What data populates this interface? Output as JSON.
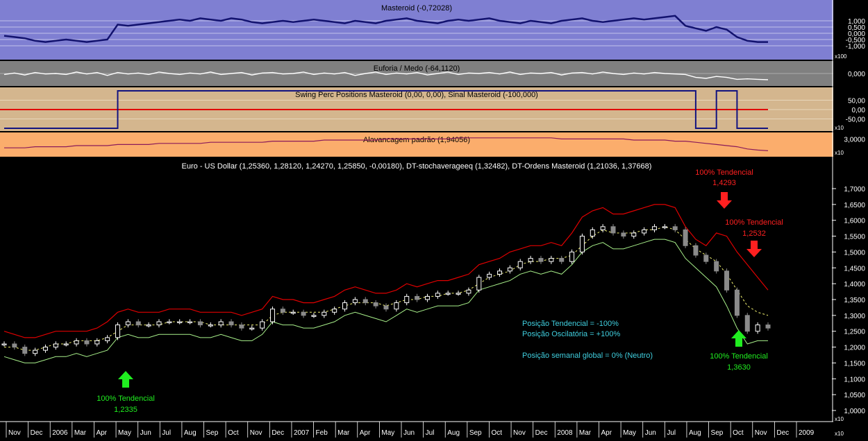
{
  "panels": {
    "masteroid": {
      "title": "Masteroid (-0,72028)",
      "ticks": [
        "1,000",
        "0,500",
        "0,000",
        "-0,500",
        "-1,000"
      ],
      "multiplier": "x100",
      "colors": {
        "bg": "#7f7fd2",
        "line": "#12126e"
      }
    },
    "euforia": {
      "title": "Euforia / Medo (-64,1120)",
      "ticks": [
        "0,000"
      ],
      "colors": {
        "bg": "#808080",
        "line": "#ffffff"
      }
    },
    "swing": {
      "title": "Swing Perc Positions Masteroid (0,00, 0,00), Sinal Masteroid (-100,000)",
      "ticks": [
        "50,00",
        "0,00",
        "-50,00"
      ],
      "multiplier": "x10",
      "colors": {
        "bg": "#d4b68e",
        "signal": "#121280",
        "perc": "#10a010",
        "zero": "#e00000"
      }
    },
    "alavancagem": {
      "title": "Alavancagem padrão (1,94056)",
      "ticks": [
        "3,0000"
      ],
      "multiplier": "x10",
      "colors": {
        "bg": "#fbad6c",
        "line": "#8a1a5a"
      }
    },
    "main": {
      "title": "Euro - US Dollar (1,25360, 1,28120, 1,24270, 1,25850, -0,00180), DT-stochaveragееq (1,32482), DT-Ordens Masteroid (1,21036, 1,37668)",
      "ticks": [
        "1,7000",
        "1,6500",
        "1,6000",
        "1,5500",
        "1,5000",
        "1,4500",
        "1,4000",
        "1,3500",
        "1,3000",
        "1,2500",
        "1,2000",
        "1,1500",
        "1,1000",
        "1,0500",
        "1,0000"
      ],
      "multiplier": "x10",
      "colors": {
        "bg": "#000000",
        "upper": "#e00000",
        "lower": "#a8f08a",
        "mid": "#f0f070",
        "candle_up": "#ffffff",
        "candle_down": "#8a8a8a"
      }
    }
  },
  "annotations": [
    {
      "id": "ann-top",
      "line1": "100% Tendencial",
      "line2": "1,4293",
      "color": "#ff2020",
      "arrow": "down"
    },
    {
      "id": "ann-right",
      "line1": "100% Tendencial",
      "line2": "1,2532",
      "color": "#ff2020",
      "arrow": "down"
    },
    {
      "id": "ann-right-bottom",
      "line1": "100% Tendencial",
      "line2": "1,3630",
      "color": "#20ee20",
      "arrow": "up"
    },
    {
      "id": "ann-left-bottom",
      "line1": "100% Tendencial",
      "line2": "1,2335",
      "color": "#20ee20",
      "arrow": "up"
    }
  ],
  "position_text": {
    "tendencial": "Posição Tendencial = -100%",
    "oscilatoria": "Posição Oscilatória = +100%",
    "global": "Posição semanal global = 0% (Neutro)",
    "color": "#40d0e0"
  },
  "x_axis": {
    "labels": [
      "Nov",
      "Dec",
      "2006",
      "Mar",
      "Apr",
      "May",
      "Jun",
      "Jul",
      "Aug",
      "Sep",
      "Oct",
      "Nov",
      "Dec",
      "2007",
      "Feb",
      "Mar",
      "Apr",
      "May",
      "Jun",
      "Jul",
      "Aug",
      "Sep",
      "Oct",
      "Nov",
      "Dec",
      "2008",
      "Mar",
      "Apr",
      "May",
      "Jun",
      "Jul",
      "Aug",
      "Sep",
      "Oct",
      "Nov",
      "Dec",
      "2009"
    ],
    "multiplier": "x10"
  },
  "chart_data": {
    "type": "line",
    "title": "Euro - US Dollar (1,25360, 1,28120, 1,24270, 1,25850, -0,00180), DT-stochaveragееq (1,32482), DT-Ordens Masteroid (1,21036, 1,37668)",
    "ylim": [
      1.0,
      1.7
    ],
    "series": [
      {
        "name": "Euro - US Dollar",
        "values": [
          1.21,
          1.2,
          1.18,
          1.19,
          1.2,
          1.21,
          1.21,
          1.22,
          1.21,
          1.22,
          1.23,
          1.27,
          1.28,
          1.27,
          1.27,
          1.28,
          1.28,
          1.28,
          1.28,
          1.27,
          1.27,
          1.28,
          1.27,
          1.26,
          1.26,
          1.28,
          1.32,
          1.31,
          1.31,
          1.3,
          1.3,
          1.31,
          1.32,
          1.34,
          1.35,
          1.34,
          1.33,
          1.32,
          1.34,
          1.36,
          1.35,
          1.36,
          1.37,
          1.37,
          1.37,
          1.38,
          1.42,
          1.43,
          1.44,
          1.45,
          1.47,
          1.48,
          1.47,
          1.48,
          1.47,
          1.5,
          1.55,
          1.57,
          1.58,
          1.56,
          1.55,
          1.56,
          1.57,
          1.58,
          1.58,
          1.57,
          1.52,
          1.49,
          1.47,
          1.44,
          1.38,
          1.3,
          1.25,
          1.27,
          1.26
        ]
      },
      {
        "name": "DT-stochaveragееq",
        "values": [
          1.2,
          1.2,
          1.19,
          1.19,
          1.2,
          1.21,
          1.21,
          1.22,
          1.22,
          1.22,
          1.23,
          1.25,
          1.27,
          1.27,
          1.27,
          1.27,
          1.28,
          1.28,
          1.28,
          1.28,
          1.27,
          1.27,
          1.27,
          1.27,
          1.27,
          1.27,
          1.3,
          1.31,
          1.31,
          1.31,
          1.31,
          1.31,
          1.32,
          1.33,
          1.34,
          1.34,
          1.34,
          1.33,
          1.34,
          1.35,
          1.35,
          1.36,
          1.36,
          1.37,
          1.37,
          1.38,
          1.4,
          1.42,
          1.43,
          1.44,
          1.46,
          1.47,
          1.47,
          1.48,
          1.48,
          1.49,
          1.52,
          1.55,
          1.57,
          1.56,
          1.56,
          1.56,
          1.57,
          1.57,
          1.58,
          1.57,
          1.54,
          1.51,
          1.49,
          1.47,
          1.43,
          1.38,
          1.33,
          1.31,
          1.3
        ]
      },
      {
        "name": "DT-Ordens Masteroid upper",
        "values": [
          1.25,
          1.24,
          1.23,
          1.23,
          1.24,
          1.25,
          1.25,
          1.25,
          1.25,
          1.26,
          1.28,
          1.31,
          1.32,
          1.31,
          1.31,
          1.31,
          1.32,
          1.32,
          1.32,
          1.31,
          1.31,
          1.31,
          1.31,
          1.3,
          1.31,
          1.32,
          1.36,
          1.35,
          1.35,
          1.34,
          1.34,
          1.35,
          1.36,
          1.38,
          1.39,
          1.38,
          1.37,
          1.37,
          1.38,
          1.4,
          1.39,
          1.4,
          1.41,
          1.41,
          1.42,
          1.43,
          1.46,
          1.47,
          1.48,
          1.5,
          1.51,
          1.52,
          1.52,
          1.53,
          1.52,
          1.56,
          1.61,
          1.63,
          1.64,
          1.62,
          1.62,
          1.63,
          1.64,
          1.65,
          1.65,
          1.64,
          1.58,
          1.54,
          1.52,
          1.56,
          1.55,
          1.5,
          1.46,
          1.42,
          1.38
        ]
      },
      {
        "name": "DT-Ordens Masteroid lower",
        "values": [
          1.17,
          1.16,
          1.15,
          1.15,
          1.16,
          1.17,
          1.17,
          1.18,
          1.17,
          1.18,
          1.19,
          1.23,
          1.24,
          1.23,
          1.23,
          1.24,
          1.24,
          1.24,
          1.24,
          1.23,
          1.23,
          1.24,
          1.23,
          1.22,
          1.22,
          1.24,
          1.28,
          1.27,
          1.27,
          1.26,
          1.26,
          1.27,
          1.28,
          1.3,
          1.31,
          1.3,
          1.29,
          1.28,
          1.3,
          1.32,
          1.31,
          1.32,
          1.33,
          1.33,
          1.33,
          1.34,
          1.38,
          1.39,
          1.4,
          1.41,
          1.43,
          1.44,
          1.43,
          1.44,
          1.43,
          1.46,
          1.5,
          1.52,
          1.53,
          1.51,
          1.51,
          1.52,
          1.53,
          1.54,
          1.54,
          1.53,
          1.48,
          1.45,
          1.42,
          1.39,
          1.33,
          1.26,
          1.21,
          1.22,
          1.22
        ]
      }
    ]
  },
  "indicators": {
    "masteroid": [
      -0.2,
      -0.3,
      -0.4,
      -0.6,
      -0.7,
      -0.6,
      -0.5,
      -0.6,
      -0.7,
      -0.6,
      -0.5,
      0.7,
      0.6,
      0.7,
      0.8,
      0.9,
      1.0,
      1.1,
      1.0,
      1.2,
      1.1,
      1.0,
      1.2,
      1.1,
      0.9,
      0.8,
      0.9,
      1.0,
      0.9,
      1.0,
      1.1,
      1.0,
      0.9,
      0.8,
      1.0,
      0.9,
      0.8,
      1.0,
      1.1,
      1.2,
      1.0,
      0.9,
      0.8,
      1.0,
      1.1,
      1.0,
      1.1,
      1.2,
      1.0,
      0.9,
      0.8,
      1.0,
      0.9,
      0.8,
      1.0,
      1.1,
      1.2,
      1.0,
      0.9,
      1.0,
      1.1,
      1.2,
      1.1,
      1.2,
      1.3,
      1.4,
      0.6,
      0.4,
      0.2,
      0.5,
      0.3,
      -0.3,
      -0.6,
      -0.7,
      -0.7
    ],
    "euforia": [
      -10,
      5,
      -15,
      10,
      -5,
      0,
      -10,
      15,
      -5,
      10,
      -20,
      10,
      -5,
      5,
      -10,
      15,
      0,
      -10,
      5,
      -5,
      15,
      -10,
      0,
      10,
      -15,
      5,
      10,
      -5,
      0,
      15,
      -10,
      5,
      -5,
      10,
      -20,
      0,
      15,
      -10,
      5,
      -5,
      10,
      -15,
      0,
      15,
      -10,
      5,
      0,
      10,
      -5,
      15,
      -10,
      5,
      0,
      10,
      -15,
      5,
      10,
      -5,
      15,
      0,
      -10,
      5,
      -5,
      10,
      0,
      -5,
      -10,
      -40,
      -50,
      -30,
      -40,
      -60,
      -55,
      -60,
      -64
    ],
    "swing_signal": [
      -100,
      -100,
      -100,
      -100,
      -100,
      -100,
      -100,
      -100,
      -100,
      -100,
      -100,
      100,
      100,
      100,
      100,
      100,
      100,
      100,
      100,
      100,
      100,
      100,
      100,
      100,
      100,
      100,
      100,
      100,
      100,
      100,
      100,
      100,
      100,
      100,
      100,
      100,
      100,
      100,
      100,
      100,
      100,
      100,
      100,
      100,
      100,
      100,
      100,
      100,
      100,
      100,
      100,
      100,
      100,
      100,
      100,
      100,
      100,
      100,
      100,
      100,
      100,
      100,
      100,
      100,
      100,
      100,
      100,
      -100,
      -100,
      100,
      100,
      -100,
      -100,
      -100,
      -100
    ],
    "alavancagem": [
      2.2,
      2.2,
      2.2,
      2.3,
      2.3,
      2.3,
      2.3,
      2.4,
      2.4,
      2.4,
      2.4,
      2.5,
      2.5,
      2.5,
      2.5,
      2.6,
      2.6,
      2.6,
      2.6,
      2.6,
      2.7,
      2.7,
      2.7,
      2.7,
      2.7,
      2.7,
      2.8,
      2.8,
      2.8,
      2.8,
      2.8,
      2.9,
      2.9,
      2.9,
      2.9,
      2.9,
      2.9,
      3.0,
      3.0,
      3.0,
      3.0,
      3.0,
      3.0,
      3.0,
      3.1,
      3.1,
      3.1,
      3.1,
      3.1,
      3.1,
      3.1,
      3.1,
      3.1,
      3.1,
      3.0,
      3.0,
      3.0,
      3.0,
      3.0,
      3.0,
      3.0,
      2.9,
      2.9,
      2.9,
      2.9,
      2.8,
      2.8,
      2.7,
      2.6,
      2.5,
      2.4,
      2.3,
      2.1,
      2.0,
      1.94
    ]
  }
}
